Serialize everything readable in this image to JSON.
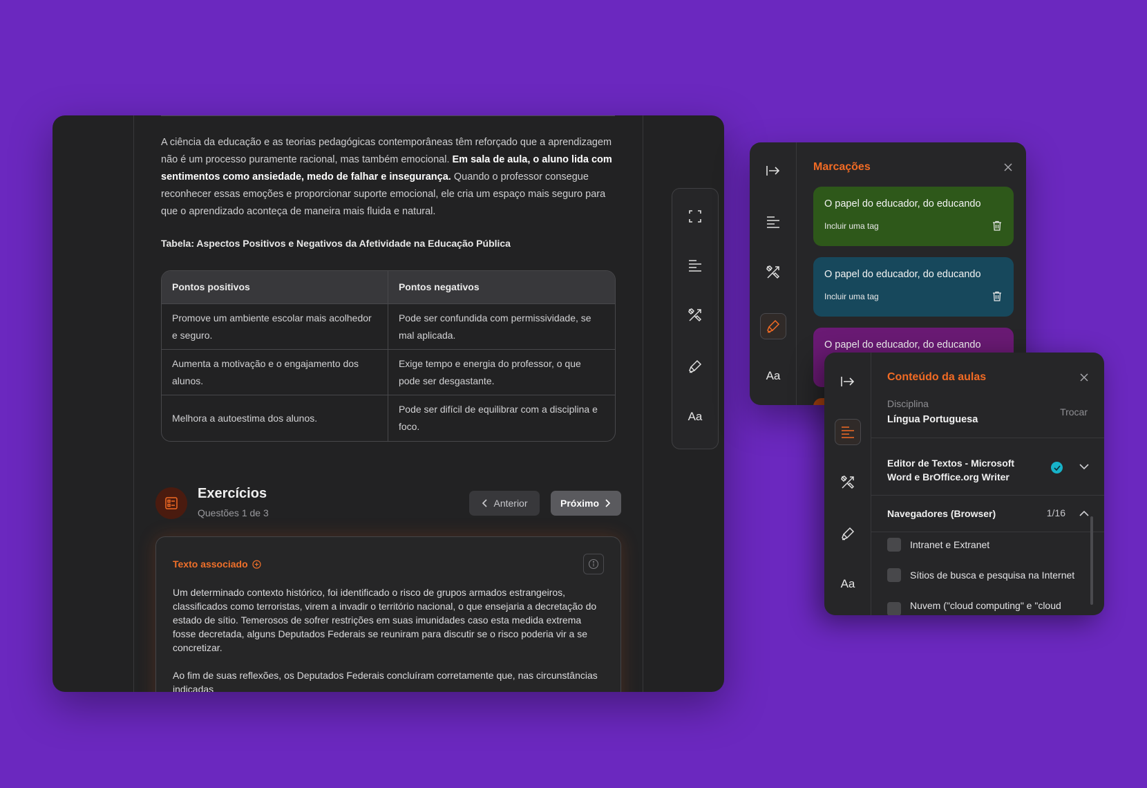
{
  "article": {
    "paragraph": {
      "part1": "A ciência da educação e as teorias pedagógicas contemporâneas têm reforçado que a aprendizagem não é um processo puramente racional, mas também emocional. ",
      "bold": "Em sala de aula, o aluno lida com sentimentos como ansiedade, medo de falhar e insegurança.",
      "part2": " Quando o professor consegue reconhecer essas emoções e proporcionar suporte emocional, ele cria um espaço mais seguro para que o aprendizado aconteça de maneira mais fluida e natural."
    },
    "table_title": "Tabela: Aspectos Positivos e Negativos da Afetividade na Educação Pública",
    "table": {
      "headers": [
        "Pontos positivos",
        "Pontos negativos"
      ],
      "rows": [
        [
          "Promove um ambiente escolar mais acolhedor e seguro.",
          "Pode ser confundida com permissividade, se mal aplicada."
        ],
        [
          "Aumenta a motivação e o engajamento dos alunos.",
          "Exige tempo e energia do professor, o que pode ser desgastante."
        ],
        [
          "Melhora a autoestima dos alunos.",
          "Pode ser difícil de equilibrar com a disciplina e foco."
        ]
      ]
    }
  },
  "exercises": {
    "title": "Exercícios",
    "subtitle": "Questões 1 de 3",
    "prev_label": "Anterior",
    "next_label": "Próximo",
    "associated": {
      "title": "Texto associado",
      "paragraphs": [
        "Um determinado contexto histórico, foi identificado o risco de grupos armados estrangeiros, classificados como terroristas, virem a invadir o território nacional, o que ensejaria a decretação do estado de sítio. Temerosos de sofrer restrições em suas imunidades caso esta medida extrema fosse decretada, alguns Deputados Federais se reuniram para discutir se o risco poderia vir a se concretizar.",
        "Ao fim de suas reflexões, os Deputados Federais concluíram corretamente que, nas circunstâncias indicadas"
      ]
    }
  },
  "tool_rail": {
    "icons": [
      "fullscreen-icon",
      "text-align-icon",
      "tools-icon",
      "highlighter-icon",
      "font-size-icon"
    ],
    "font_label": "Aa"
  },
  "marcacoes": {
    "title": "Marcações",
    "font_label": "Aa",
    "cards": [
      {
        "title": "O papel do educador, do educando",
        "tag_label": "Incluir uma tag",
        "color": "#2e581a"
      },
      {
        "title": "O papel do educador, do educando",
        "tag_label": "Incluir uma tag",
        "color": "#17485c"
      },
      {
        "title": "O papel do educador, do educando",
        "color": "#6a1a74"
      }
    ]
  },
  "conteudo": {
    "title": "Conteúdo da aulas",
    "font_label": "Aa",
    "disciplina_label": "Disciplina",
    "disciplina_value": "Língua Portuguesa",
    "trocar_label": "Trocar",
    "section1": {
      "title": "Editor de Textos - Microsoft Word e BrOffice.org Writer"
    },
    "section2": {
      "title": "Navegadores (Browser)",
      "count": "1/16"
    },
    "items": [
      "Intranet e Extranet",
      "Sítios de busca e pesquisa na Internet",
      "Nuvem (\"cloud computing\" e \"cloud storage\")"
    ]
  },
  "colors": {
    "background": "#6b28bf",
    "accent": "#f26b24",
    "check_teal": "#17b3c9"
  }
}
